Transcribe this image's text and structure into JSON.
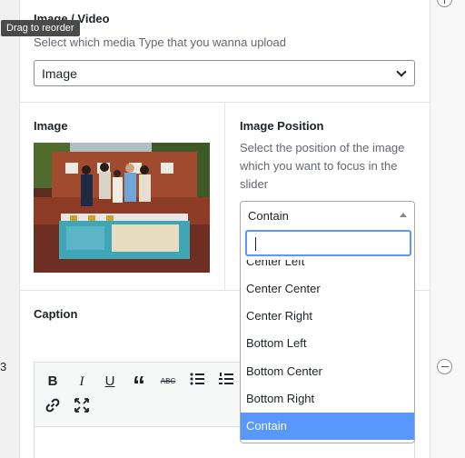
{
  "tooltip": "Drag to reorder",
  "row_number": "3",
  "media": {
    "label": "Image / Video",
    "description": "Select which media Type that you wanna upload",
    "selected": "Image"
  },
  "image": {
    "label": "Image"
  },
  "position": {
    "label": "Image Position",
    "description_lines": [
      "Select the position of the image",
      "which you want to focus in the",
      "slider"
    ],
    "selected": "Contain",
    "options": [
      "Center Left",
      "Center Center",
      "Center Right",
      "Bottom Left",
      "Bottom Center",
      "Bottom Right",
      "Contain"
    ],
    "highlighted_index": 6
  },
  "caption": {
    "label": "Caption"
  },
  "toolbar": {
    "icons": [
      "bold-icon",
      "italic-icon",
      "underline-icon",
      "blockquote-icon",
      "strikethrough-icon",
      "bullet-list-icon",
      "numbered-list-icon",
      "link-icon",
      "fullscreen-icon"
    ],
    "glyphs": {
      "bold": "B",
      "italic": "I",
      "underline": "U",
      "quote": "“",
      "strike": "ABC"
    }
  },
  "colors": {
    "accent": "#5897fb",
    "border": "#8c8f94"
  }
}
